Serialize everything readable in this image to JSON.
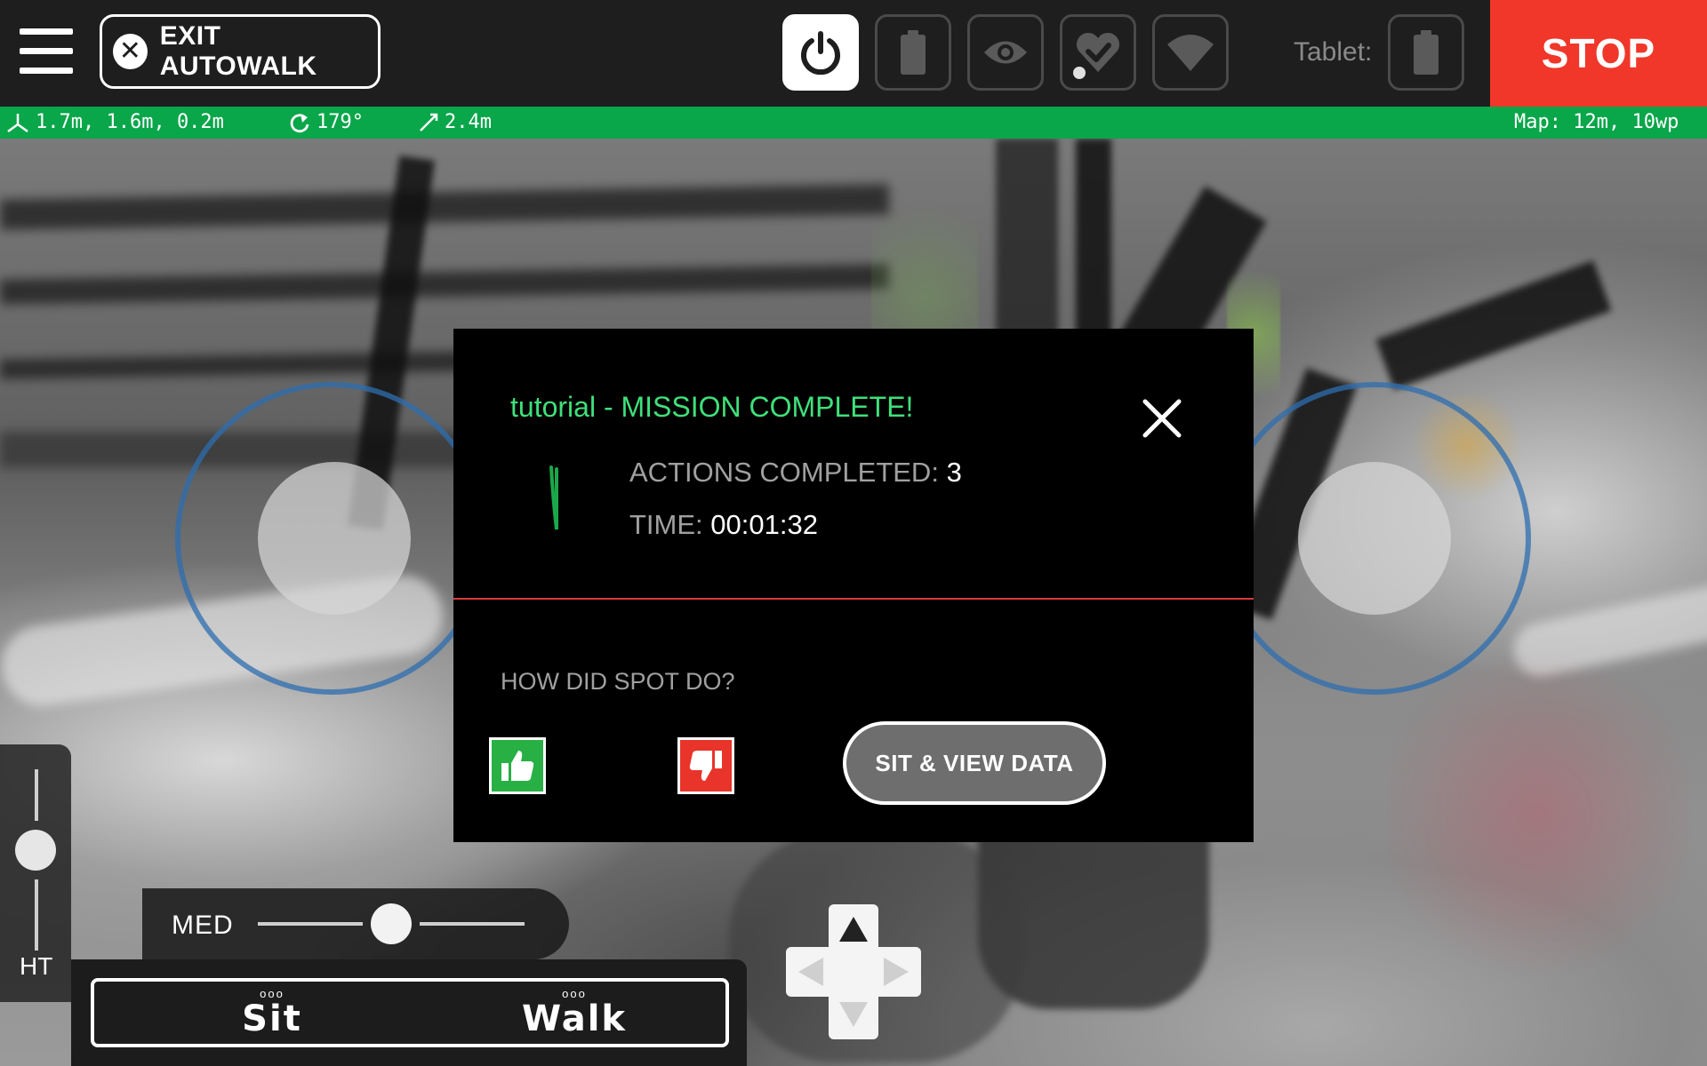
{
  "topbar": {
    "exit_label": "EXIT AUTOWALK",
    "tablet_label": "Tablet:",
    "stop_label": "STOP",
    "icons": [
      "power-icon",
      "battery-icon",
      "eye-icon",
      "heart-check-icon",
      "wifi-icon",
      "tablet-battery-icon"
    ]
  },
  "status": {
    "position": "1.7m, 1.6m, 0.2m",
    "rotation": "179°",
    "distance": "2.4m",
    "map": "Map: 12m, 10wp"
  },
  "dialog": {
    "title": "tutorial - MISSION COMPLETE!",
    "actions_label": "ACTIONS COMPLETED:",
    "actions_value": "3",
    "time_label": "TIME:",
    "time_value": "00:01:32",
    "question": "HOW DID SPOT DO?",
    "sit_view_label": "SIT & VIEW DATA"
  },
  "controls": {
    "height_label": "HT",
    "speed_label": "MED",
    "sit_label": "Sit",
    "walk_label": "Walk",
    "mode_dots": "ooo"
  },
  "colors": {
    "stop": "#f0372a",
    "status_bar": "#0aa64a",
    "title_green": "#3fe07a",
    "divider_red": "#d83a3a",
    "thumbs_up": "#28b044",
    "thumbs_down": "#e8342a"
  }
}
